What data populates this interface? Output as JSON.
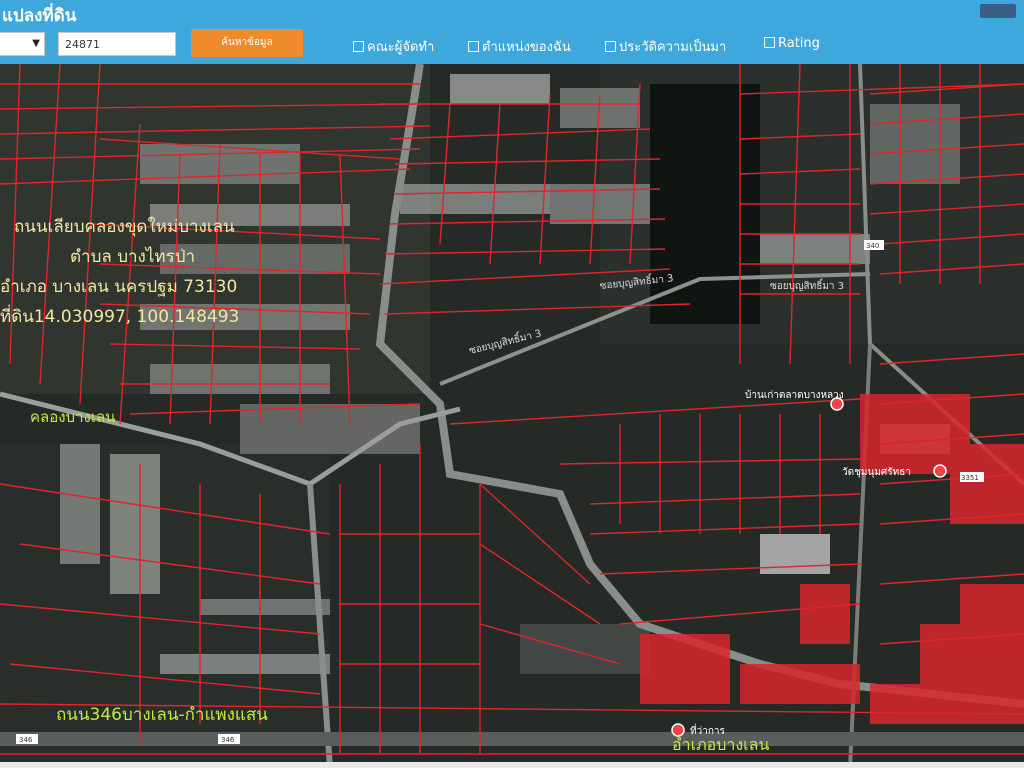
{
  "header": {
    "title": "แปลงที่ดิน",
    "search_value": "24871",
    "search_button": "ค้นหาข้อมูล",
    "checkboxes": [
      "คณะผู้จัดทำ",
      "ตำแหน่งของฉัน",
      "ประวัติความเป็นมา",
      "Rating"
    ]
  },
  "map": {
    "info_lines": [
      "ถนนเลียบคลองขุดใหม่บางเลน",
      "ตำบล บางไทรป่า",
      "อำเภอ บางเลน นครปฐม 73130",
      "ที่ดิน14.030997, 100.148493"
    ],
    "canal_label": "คลองบางเลน",
    "road_label": "ถนน346บางเลน-กำแพงแสน",
    "district_label": "อำเภอบางเลน",
    "soi_label": "ซอยบุญสิทธิ์มา 3",
    "market_label": "บ้านเก่าตลาดบางหลวง",
    "temple_label": "วัดชุมนุมศรัทธา",
    "office_label": "ที่ว่าการ",
    "road_markers": [
      "346",
      "346",
      "340",
      "3351"
    ],
    "colors": {
      "parcel_line": "#e0252b",
      "map_text": "#f2e9a0",
      "road_text": "#c4e84a"
    }
  }
}
